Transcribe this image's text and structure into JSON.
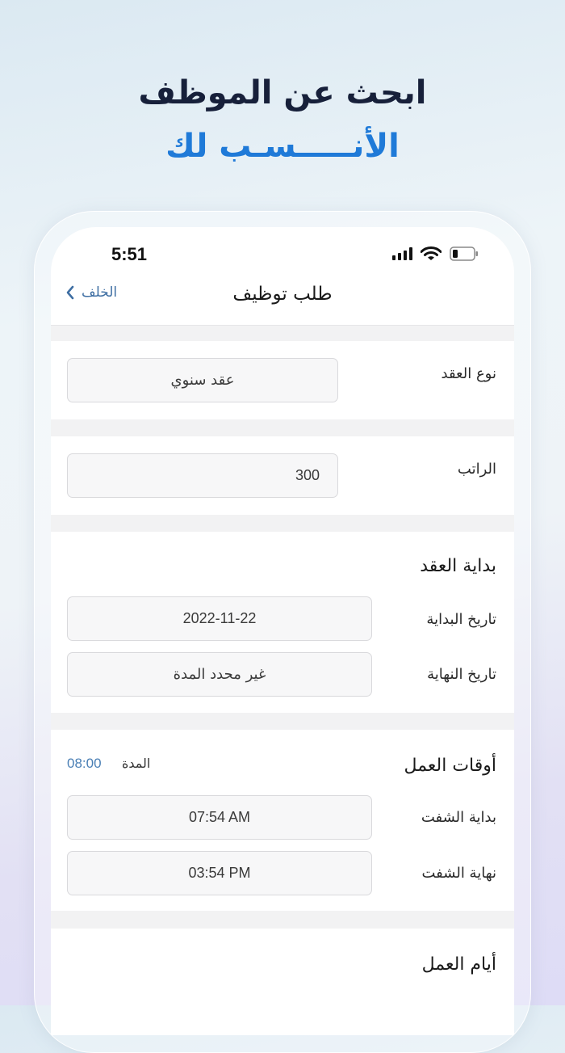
{
  "promo": {
    "line1": "ابحث عن الموظف",
    "line2": "الأنـــــسـب لك"
  },
  "status_bar": {
    "time": "5:51",
    "icons": [
      "signal-icon",
      "wifi-icon",
      "battery-icon"
    ]
  },
  "nav": {
    "back_label": "الخلف",
    "title": "طلب توظيف"
  },
  "contract_type": {
    "label": "نوع العقد",
    "value": "عقد سنوي"
  },
  "salary": {
    "label": "الراتب",
    "value": "300"
  },
  "contract_start": {
    "title": "بداية العقد",
    "start_label": "تاريخ البداية",
    "start_value": "2022-11-22",
    "end_label": "تاريخ النهاية",
    "end_value": "غير محدد المدة"
  },
  "working_hours": {
    "title": "أوقات العمل",
    "duration_label": "المدة",
    "duration_value": "08:00",
    "shift_start_label": "بداية الشفت",
    "shift_start_value": "07:54 AM",
    "shift_end_label": "نهاية الشفت",
    "shift_end_value": "03:54 PM"
  },
  "working_days": {
    "title": "أيام العمل"
  },
  "colors": {
    "accent_blue": "#1f7ad8",
    "link_blue": "#3f6fa3",
    "dark_text": "#17203a"
  }
}
